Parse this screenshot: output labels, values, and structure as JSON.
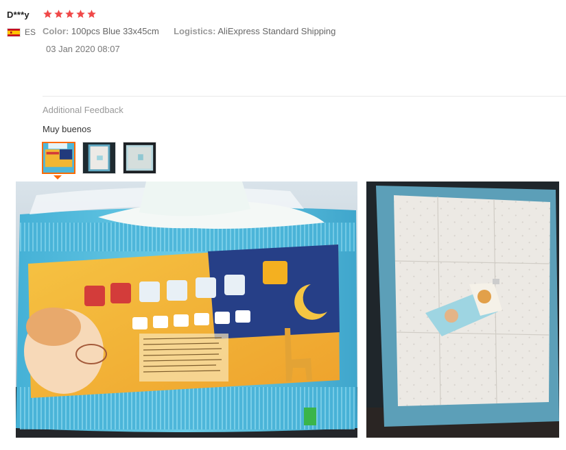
{
  "review": {
    "reviewer_name": "D***y",
    "country_code": "ES",
    "rating": 5,
    "star_color": "#f04848",
    "color_label": "Color:",
    "color_value": "100pcs Blue 33x45cm",
    "logistics_label": "Logistics:",
    "logistics_value": "AliExpress Standard Shipping",
    "date": "03 Jan 2020 08:07",
    "additional_feedback_title": "Additional Feedback",
    "additional_feedback_text": "Muy buenos",
    "active_thumbnail_color": "#ff6a00"
  },
  "icons": {
    "flag": "spain-flag-icon",
    "star": "star-icon"
  },
  "photos": {
    "thumbnails": [
      "photo-thumbnail-1",
      "photo-thumbnail-2",
      "photo-thumbnail-3"
    ],
    "large": [
      "diaper-pack-photo",
      "underpad-photo"
    ]
  }
}
